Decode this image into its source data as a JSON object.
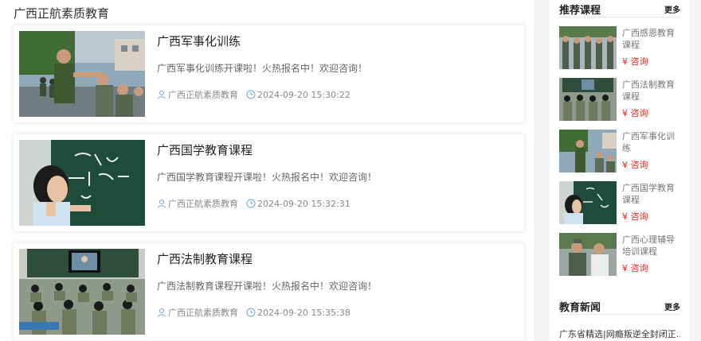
{
  "main": {
    "title": "广西正航素质教育",
    "articles": [
      {
        "title": "广西军事化训练",
        "desc": "广西军事化训练开课啦！火热报名中！欢迎咨询！",
        "author": "广西正航素质教育",
        "date": "2024-09-20 15:30:22"
      },
      {
        "title": "广西国学教育课程",
        "desc": "广西国学教育课程开课啦！火热报名中！欢迎咨询！",
        "author": "广西正航素质教育",
        "date": "2024-09-20 15:32:31"
      },
      {
        "title": "广西法制教育课程",
        "desc": "广西法制教育课程开课啦！火热报名中！欢迎咨询！",
        "author": "广西正航素质教育",
        "date": "2024-09-20 15:35:38"
      }
    ]
  },
  "sidebar": {
    "recommended": {
      "heading": "推荐课程",
      "more": "更多",
      "consult_label": "¥ 咨询",
      "items": [
        {
          "name": "广西感恩教育课程"
        },
        {
          "name": "广西法制教育课程"
        },
        {
          "name": "广西军事化训练"
        },
        {
          "name": "广西国学教育课程"
        },
        {
          "name": "广西心理辅导培训课程"
        }
      ]
    },
    "news": {
      "heading": "教育新闻",
      "more": "更多",
      "items": [
        {
          "title": "广东省精选|网瘾叛逆全封闭正..."
        }
      ]
    }
  },
  "colors": {
    "accent_price": "#e0251b",
    "meta_icon": "#6fa3d8"
  }
}
